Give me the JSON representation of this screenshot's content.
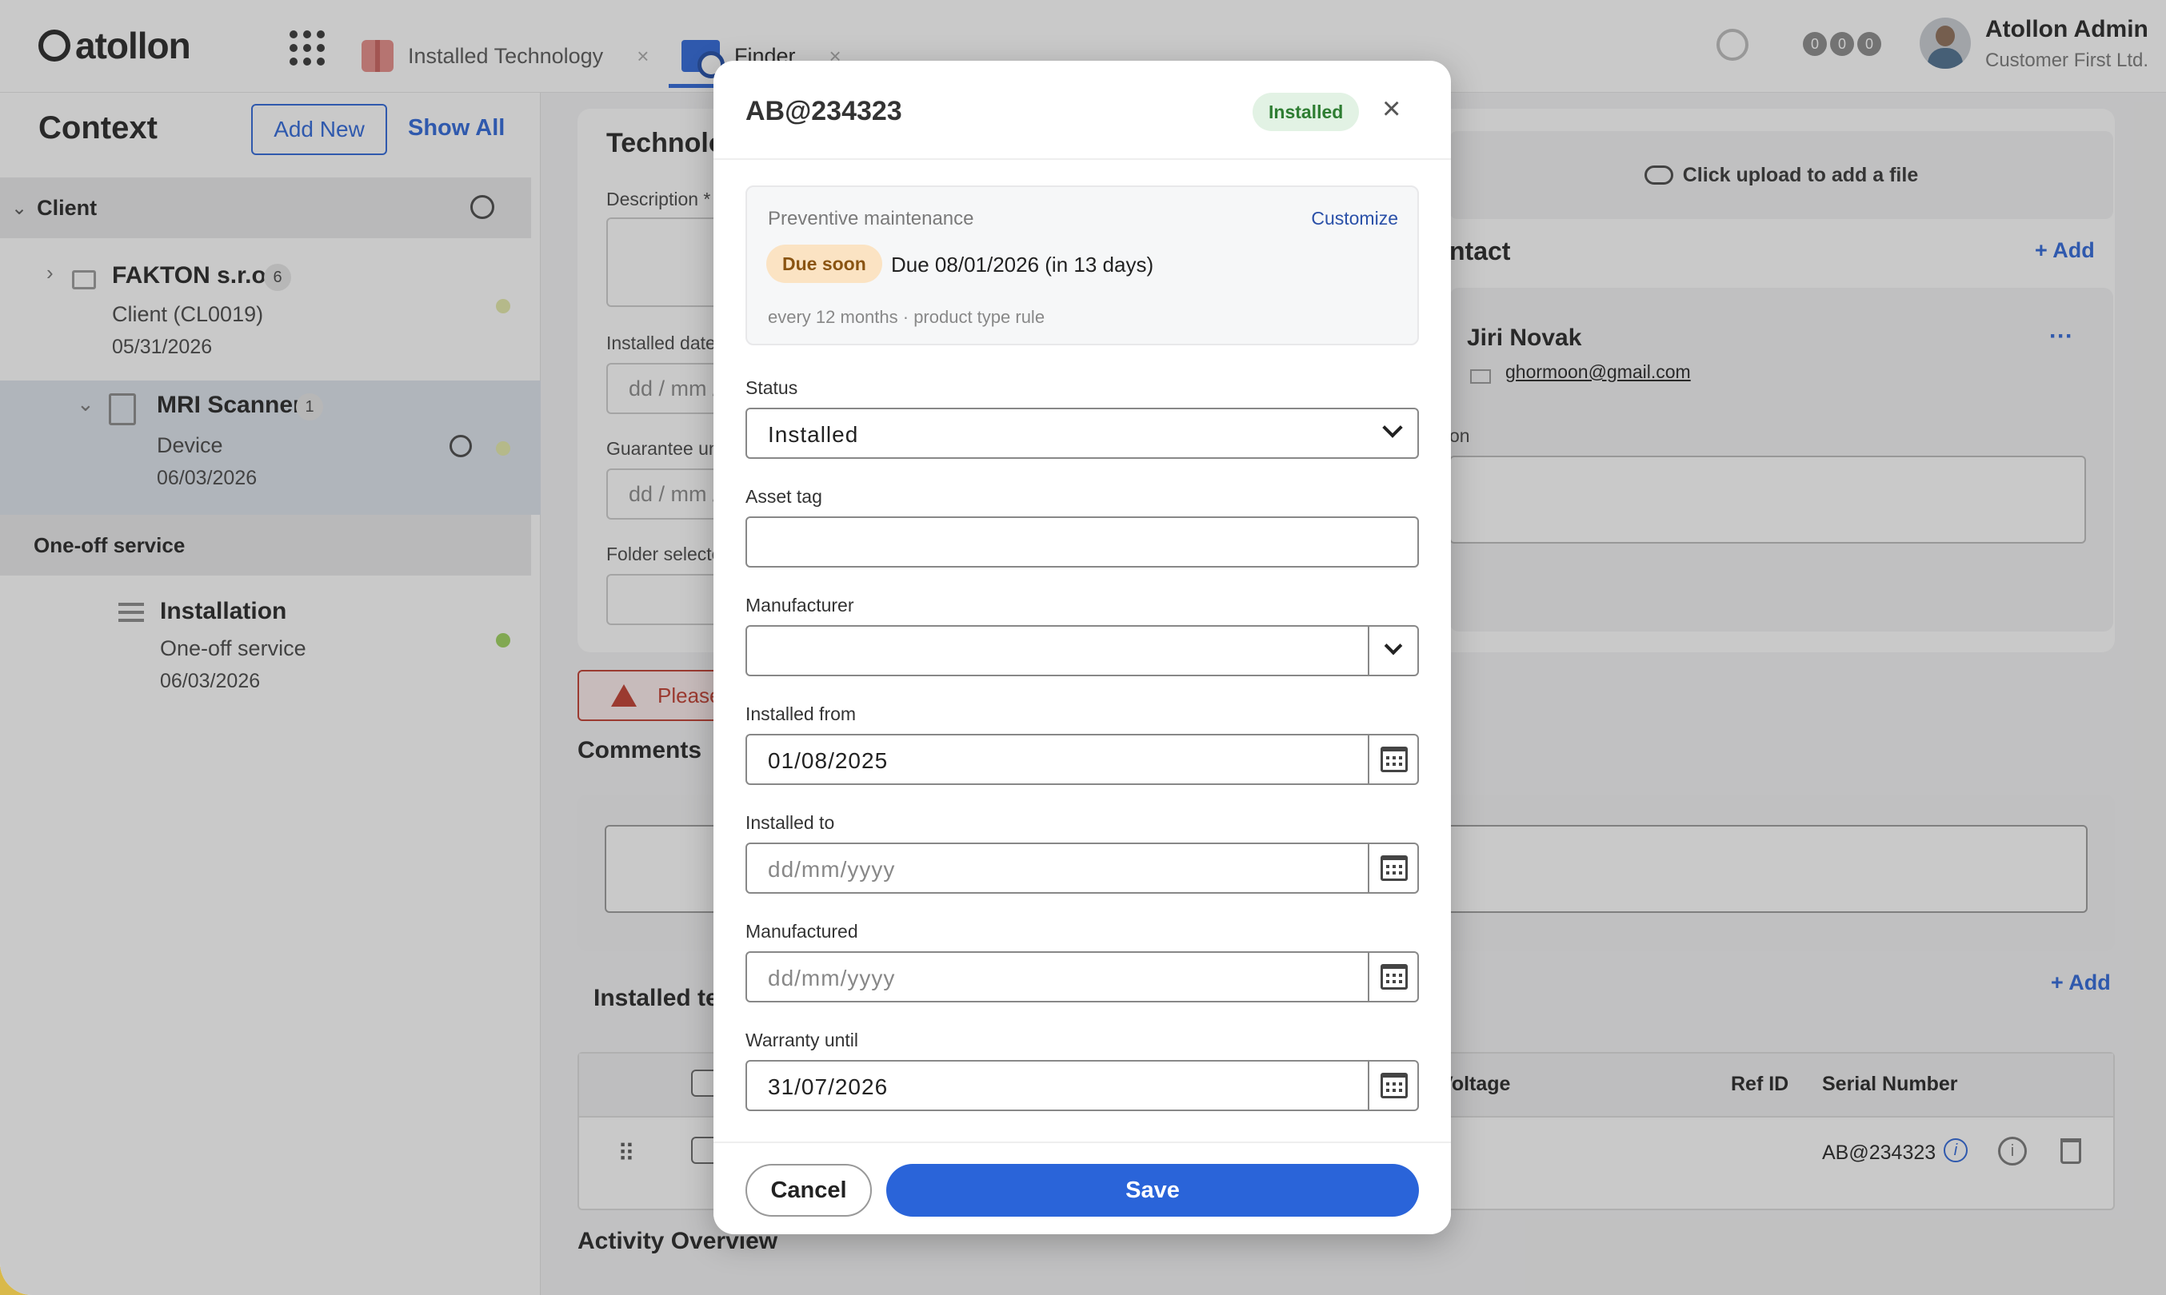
{
  "app": {
    "logo_text": "atollon",
    "tabs": [
      {
        "label": "Installed Technology",
        "icon": "package-icon"
      },
      {
        "label": "Finder",
        "icon": "folder-search-icon"
      }
    ],
    "tab_close": "×",
    "notification_dots": [
      "0",
      "0",
      "0"
    ],
    "user": {
      "name": "Atollon Admin",
      "org": "Customer First Ltd."
    },
    "accent": "#2a64d9"
  },
  "context": {
    "title": "Context",
    "add_new": "Add New",
    "show_all": "Show All",
    "client_section": "Client",
    "items": [
      {
        "name": "FAKTON s.r.o.",
        "count": "6",
        "sub": "Client (CL0019)",
        "date": "05/31/2026"
      },
      {
        "name": "MRI Scanner",
        "count": "1",
        "sub": "Device",
        "date": "06/03/2026"
      }
    ],
    "oneoff_section": "One-off service",
    "oneoff_item": {
      "name": "Installation",
      "sub": "One-off service",
      "date": "06/03/2026"
    }
  },
  "main": {
    "title": "Technolo",
    "description_label": "Description *",
    "installed_date_label": "Installed date:",
    "installed_date_ph": "dd / mm /",
    "guarantee_label": "Guarantee un",
    "guarantee_ph": "dd / mm /",
    "folder_label": "Folder selecto",
    "upload_text": "Click upload to add a file",
    "contact_title": "ntact",
    "add_label": "Add",
    "contact_name": "Jiri Novak",
    "contact_email": "ghormoon@gmail.com",
    "contact_more": "···",
    "note_label": "on",
    "alert_text": "Please",
    "comments_title": "Comments",
    "installed_tech_title": "Installed te",
    "table": {
      "headers": {
        "voltage": "Voltage",
        "ref_id": "Ref ID",
        "serial": "Serial Number"
      },
      "row": {
        "serial": "AB@234323",
        "drag": "⠿"
      }
    },
    "activity_title": "Activity Overview"
  },
  "modal": {
    "title": "AB@234323",
    "status_badge": "Installed",
    "close": "×",
    "pm": {
      "title": "Preventive maintenance",
      "customize": "Customize",
      "due_badge": "Due soon",
      "due_text": "Due 08/01/2026 (in 13 days)",
      "rule": "every 12 months · product type rule"
    },
    "fields": {
      "status_label": "Status",
      "status_value": "Installed",
      "asset_tag_label": "Asset tag",
      "asset_tag_value": "",
      "manufacturer_label": "Manufacturer",
      "manufacturer_value": "",
      "installed_from_label": "Installed from",
      "installed_from_value": "01/08/2025",
      "installed_to_label": "Installed to",
      "installed_to_ph": "dd/mm/yyyy",
      "manufactured_label": "Manufactured",
      "manufactured_ph": "dd/mm/yyyy",
      "warranty_label": "Warranty until",
      "warranty_value": "31/07/2026"
    },
    "cancel": "Cancel",
    "save": "Save"
  }
}
